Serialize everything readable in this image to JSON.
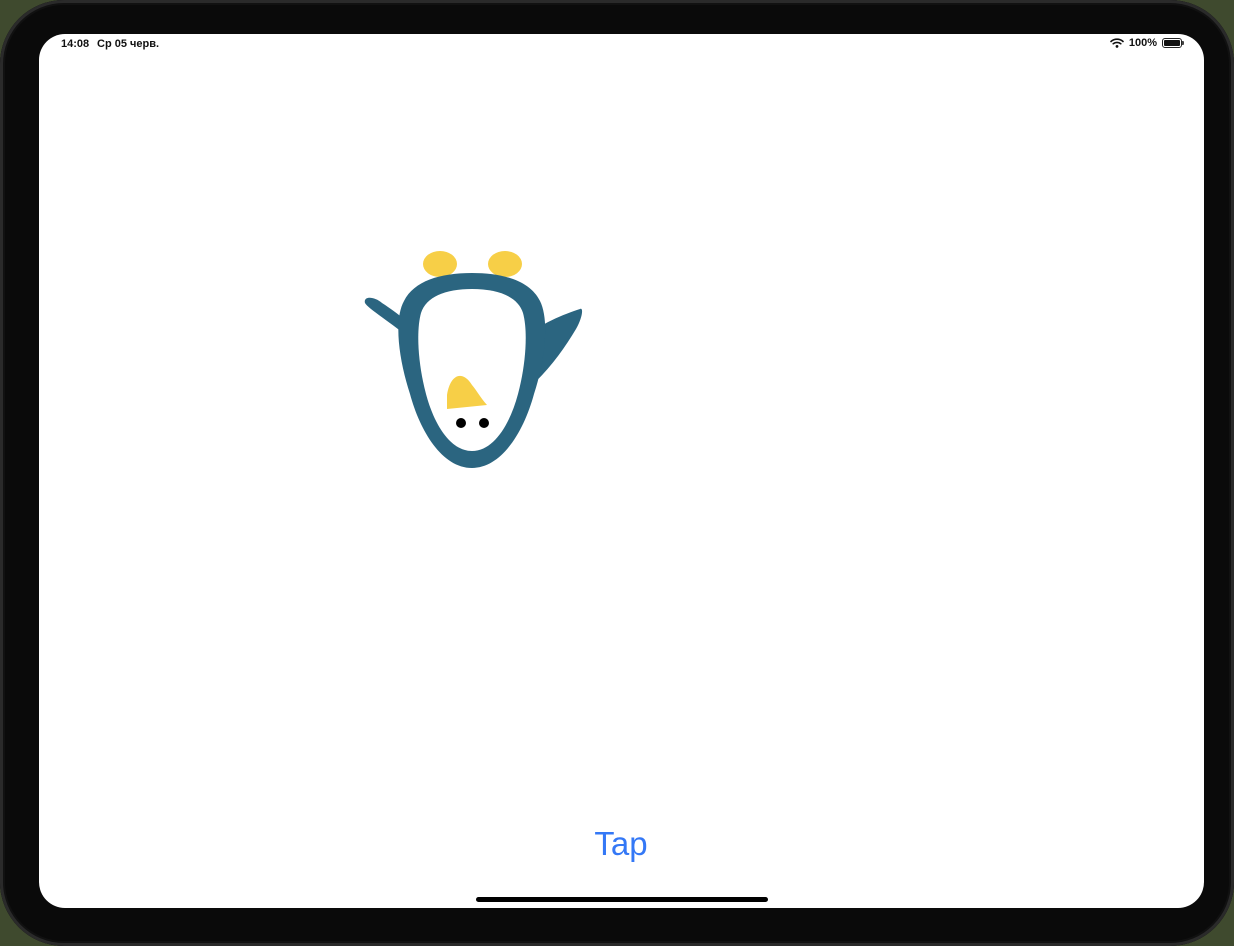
{
  "status_bar": {
    "time": "14:08",
    "date": "Ср 05 черв.",
    "battery_percent": "100%",
    "wifi_icon": "wifi-icon",
    "battery_icon": "battery-icon",
    "battery_level": 1.0
  },
  "main": {
    "illustration": "upside-down-penguin",
    "colors": {
      "penguin_body": "#2b6580",
      "penguin_feet_beak": "#f7cf47",
      "eyes": "#000000",
      "background": "#ffffff"
    },
    "tap_label": "Tap",
    "accent": "#3478f6"
  }
}
